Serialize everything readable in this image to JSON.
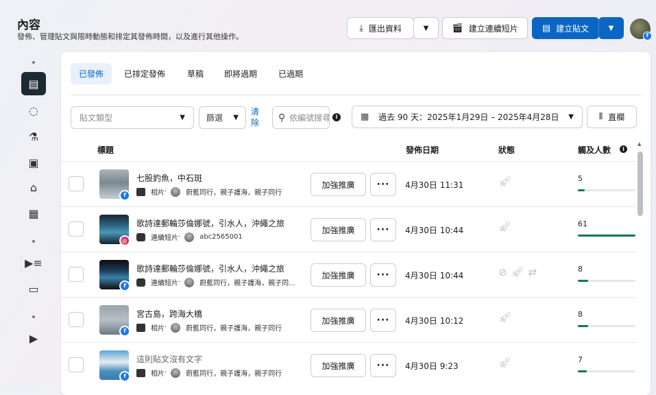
{
  "header": {
    "title": "內容",
    "subtitle": "發佈、管理貼文與限時動態和排定其發佈時間，以及進行其他操作。",
    "export_label": "匯出資料",
    "reel_label": "建立連續短片",
    "create_label": "建立貼文"
  },
  "tabs": [
    {
      "label": "已發佈"
    },
    {
      "label": "已排定發佈"
    },
    {
      "label": "草稿"
    },
    {
      "label": "即將過期"
    },
    {
      "label": "已過期"
    }
  ],
  "filters": {
    "post_type_placeholder": "貼文類型",
    "filter_label": "篩選",
    "clear_label": "清除",
    "search_placeholder": "依編號搜尋",
    "date_range": "過去 90 天：2025年1月29日 – 2025年4月28日",
    "columns_label": "直欄"
  },
  "columns": {
    "title": "標題",
    "date": "發佈日期",
    "status": "狀態",
    "reach": "觸及人數"
  },
  "colors": {
    "accent": "#0a66c2",
    "reach_bar": "#0b7a4b"
  },
  "rows": [
    {
      "title": "七股釣魚，中石斑",
      "type": "相片",
      "sep": "·",
      "account": "蔚藍同行，親子護海，親子同行",
      "date": "4月30日 11:31",
      "reach": "5",
      "reach_fraction": 0.12,
      "boost": "加強推廣",
      "platform": "facebook"
    },
    {
      "title": "歌詩達郵輪莎倫娜號，引水人，沖繩之旅",
      "type": "連續短片",
      "sep": "·",
      "account": "abc2565001",
      "date": "4月30日 10:44",
      "reach": "61",
      "reach_fraction": 1.0,
      "boost": "加強推廣",
      "platform": "instagram"
    },
    {
      "title": "歌詩達郵輪莎倫娜號，引水人，沖繩之旅",
      "type": "連續短片",
      "sep": "·",
      "account": "蔚藍同行，親子護海，親子同...",
      "date": "4月30日 10:44",
      "reach": "8",
      "reach_fraction": 0.18,
      "boost": "加強推廣",
      "platform": "facebook"
    },
    {
      "title": "宮古島，跨海大橋",
      "type": "相片",
      "sep": "·",
      "account": "蔚藍同行，親子護海，親子同行",
      "date": "4月30日 10:12",
      "reach": "8",
      "reach_fraction": 0.18,
      "boost": "加強推廣",
      "platform": "facebook"
    },
    {
      "title": "這則貼文沒有文字",
      "type": "相片",
      "sep": "·",
      "account": "蔚藍同行，親子護海，親子同行",
      "date": "4月30日 9:23",
      "reach": "7",
      "reach_fraction": 0.16,
      "boost": "加強推廣",
      "platform": "facebook"
    }
  ]
}
